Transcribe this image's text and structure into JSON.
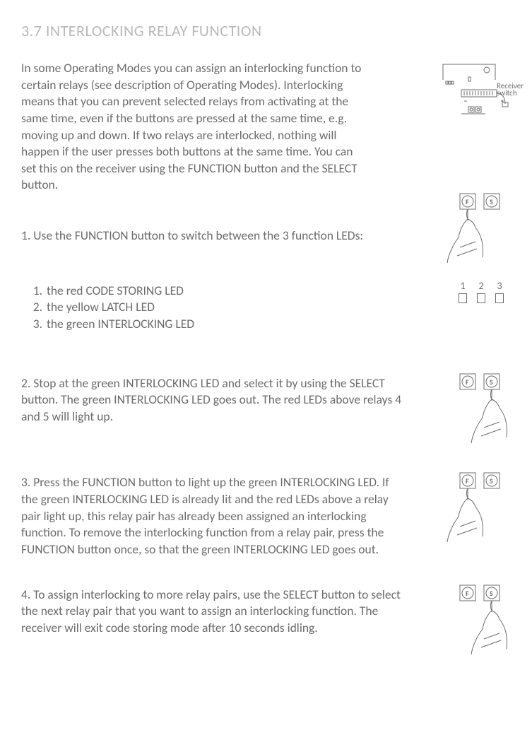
{
  "title": "3.7 INTERLOCKING RELAY FUNCTION",
  "intro": "In some Operating Modes you can assign an interlocking function to certain relays (see description of Operating Modes). Interlocking means that you can prevent selected relays from activating at the same time, even if the buttons are pressed at the same time, e.g. moving up and down. If two relays are interlocked, nothing will happen if the user presses both buttons at the same time. You can set this on the receiver using the FUNCTION button and the SELECT button.",
  "receiver_label_line1": "Receiver",
  "receiver_label_line2": "switch",
  "step1_intro": "1. Use the FUNCTION button to switch between the 3 function LEDs:",
  "leds": {
    "items": [
      "the red CODE STORING LED",
      "the yellow LATCH LED",
      "the green INTERLOCKING LED"
    ],
    "numbers": [
      "1",
      "2",
      "3"
    ]
  },
  "step2": "2. Stop at the green INTERLOCKING LED and select it by using the SELECT button. The green INTERLOCKING LED goes out. The red LEDs above relays 4 and 5 will light up.",
  "step3": "3. Press the FUNCTION button to light up the green INTERLOCKING LED. If the green INTERLOCKING LED is already lit and the red LEDs above a relay pair light up, this relay pair has already been assigned an interlocking function. To remove the interlocking function from a relay pair, press the FUNCTION button once, so that the green INTERLOCKING LED goes out.",
  "step4": "4. To assign interlocking to more relay pairs, use the SELECT button to select the next relay pair that you want to assign an interlocking function. The receiver will exit code storing mode after 10 seconds idling.",
  "buttons": {
    "F": "F",
    "S": "S"
  }
}
